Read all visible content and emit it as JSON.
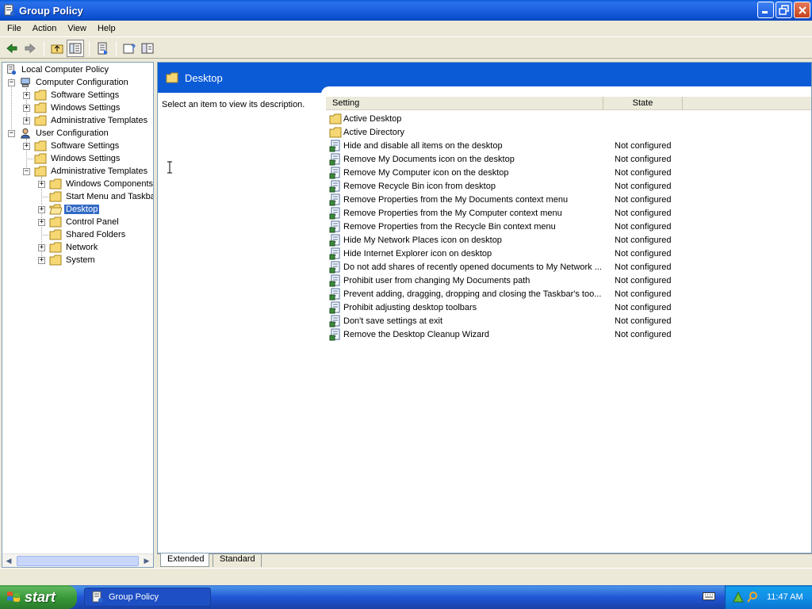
{
  "window": {
    "title": "Group Policy",
    "icon": "group-policy-icon"
  },
  "menu": [
    "File",
    "Action",
    "View",
    "Help"
  ],
  "toolbar": {
    "icons": [
      "back-arrow-icon",
      "forward-arrow-icon",
      "up-folder-icon",
      "show-hide-tree-icon",
      "export-list-icon",
      "help-icon",
      "properties-icon"
    ]
  },
  "tree": {
    "root": "Local Computer Policy",
    "computer_config": "Computer Configuration",
    "cc_software": "Software Settings",
    "cc_windows": "Windows Settings",
    "cc_admin": "Administrative Templates",
    "user_config": "User Configuration",
    "uc_software": "Software Settings",
    "uc_windows": "Windows Settings",
    "uc_admin": "Administrative Templates",
    "wincomp": "Windows Components",
    "startmenu": "Start Menu and Taskba",
    "desktop": "Desktop",
    "control_panel": "Control Panel",
    "shared_folders": "Shared Folders",
    "network": "Network",
    "system": "System"
  },
  "right": {
    "header": "Desktop",
    "description": "Select an item to view its description.",
    "columns": {
      "setting": "Setting",
      "state": "State"
    },
    "folders": [
      "Active Desktop",
      "Active Directory"
    ],
    "settings": [
      {
        "name": "Hide and disable all items on the desktop",
        "state": "Not configured"
      },
      {
        "name": "Remove My Documents icon on the desktop",
        "state": "Not configured"
      },
      {
        "name": "Remove My Computer icon on the desktop",
        "state": "Not configured"
      },
      {
        "name": "Remove Recycle Bin icon from desktop",
        "state": "Not configured"
      },
      {
        "name": "Remove Properties from the My Documents context menu",
        "state": "Not configured"
      },
      {
        "name": "Remove Properties from the My Computer context menu",
        "state": "Not configured"
      },
      {
        "name": "Remove Properties from the Recycle Bin context menu",
        "state": "Not configured"
      },
      {
        "name": "Hide My Network Places icon on desktop",
        "state": "Not configured"
      },
      {
        "name": "Hide Internet Explorer icon on desktop",
        "state": "Not configured"
      },
      {
        "name": "Do not add shares of recently opened documents to My Network ...",
        "state": "Not configured"
      },
      {
        "name": "Prohibit user from changing My Documents path",
        "state": "Not configured"
      },
      {
        "name": "Prevent adding, dragging, dropping and closing the Taskbar's too...",
        "state": "Not configured"
      },
      {
        "name": "Prohibit adjusting desktop toolbars",
        "state": "Not configured"
      },
      {
        "name": "Don't save settings at exit",
        "state": "Not configured"
      },
      {
        "name": "Remove the Desktop Cleanup Wizard",
        "state": "Not configured"
      }
    ]
  },
  "tabs": [
    "Extended",
    "Standard"
  ],
  "taskbar": {
    "start": "start",
    "task": "Group Policy",
    "clock": "11:47 AM"
  },
  "colors": {
    "title_blue": "#0a5bd8",
    "header_blue": "#0b5bd7",
    "selection": "#316ac5",
    "start_green": "#3a9a3a"
  }
}
